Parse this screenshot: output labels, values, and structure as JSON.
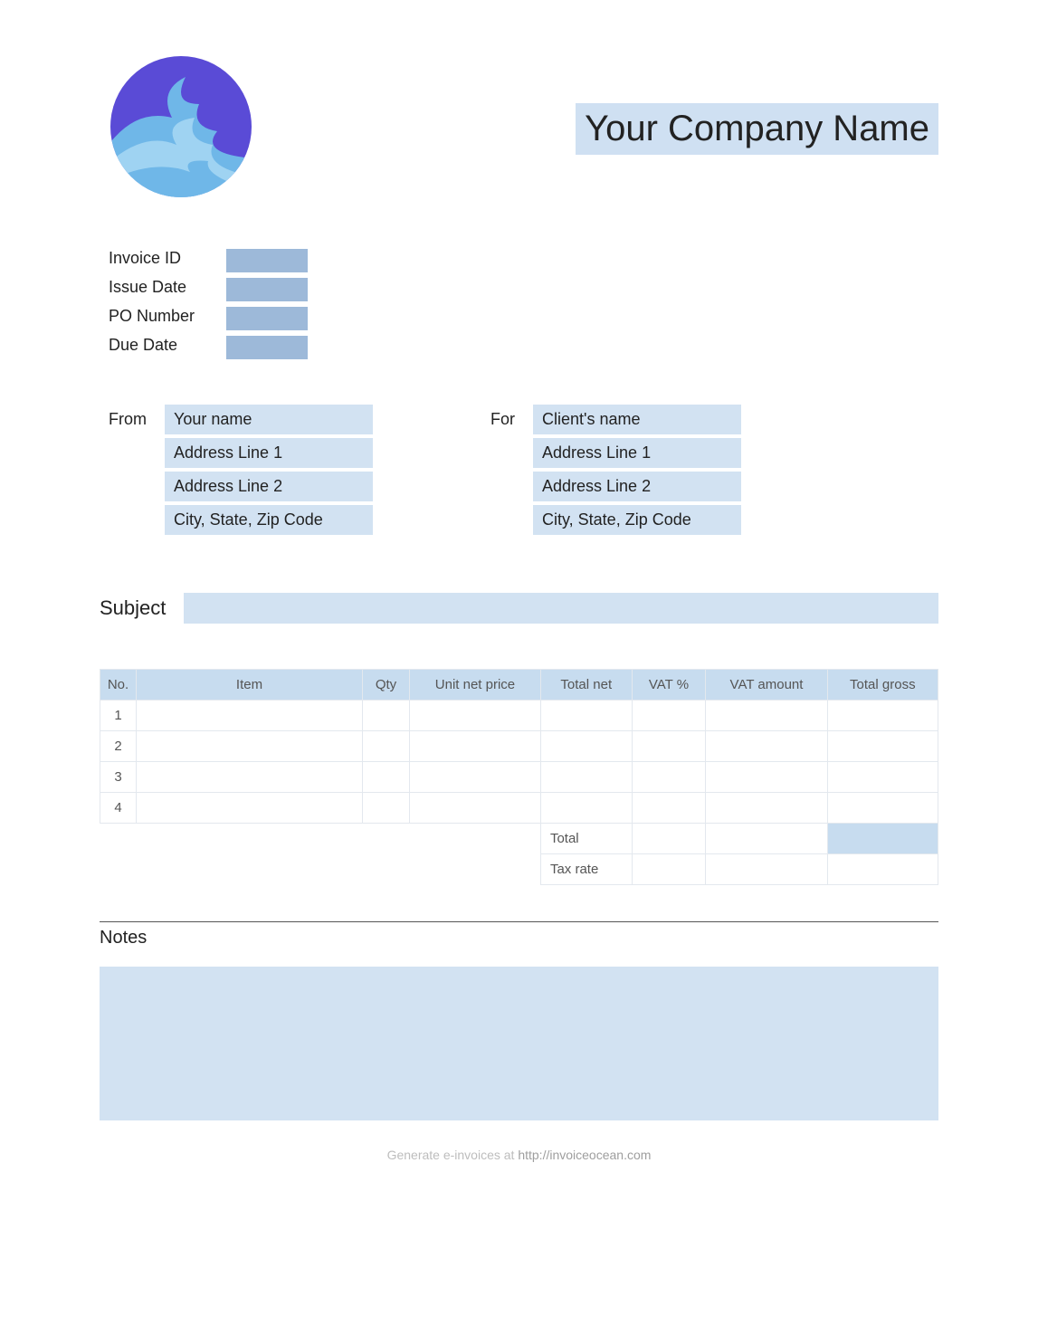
{
  "header": {
    "company_name": "Your Company Name"
  },
  "meta": {
    "invoice_id_label": "Invoice ID",
    "issue_date_label": "Issue Date",
    "po_number_label": "PO Number",
    "due_date_label": "Due Date",
    "invoice_id": "",
    "issue_date": "",
    "po_number": "",
    "due_date": ""
  },
  "from": {
    "label": "From",
    "lines": [
      "Your name",
      "Address Line 1",
      "Address Line 2",
      "City, State, Zip Code"
    ]
  },
  "for": {
    "label": "For",
    "lines": [
      "Client's name",
      "Address Line 1",
      "Address Line 2",
      "City, State, Zip Code"
    ]
  },
  "subject": {
    "label": "Subject",
    "value": ""
  },
  "table": {
    "headers": {
      "no": "No.",
      "item": "Item",
      "qty": "Qty",
      "unit_net_price": "Unit net price",
      "total_net": "Total net",
      "vat_pct": "VAT %",
      "vat_amount": "VAT amount",
      "total_gross": "Total gross"
    },
    "rows": [
      {
        "no": "1",
        "item": "",
        "qty": "",
        "unit_net_price": "",
        "total_net": "",
        "vat_pct": "",
        "vat_amount": "",
        "total_gross": ""
      },
      {
        "no": "2",
        "item": "",
        "qty": "",
        "unit_net_price": "",
        "total_net": "",
        "vat_pct": "",
        "vat_amount": "",
        "total_gross": ""
      },
      {
        "no": "3",
        "item": "",
        "qty": "",
        "unit_net_price": "",
        "total_net": "",
        "vat_pct": "",
        "vat_amount": "",
        "total_gross": ""
      },
      {
        "no": "4",
        "item": "",
        "qty": "",
        "unit_net_price": "",
        "total_net": "",
        "vat_pct": "",
        "vat_amount": "",
        "total_gross": ""
      }
    ],
    "totals": {
      "total_label": "Total",
      "tax_rate_label": "Tax rate",
      "total_vat_pct": "",
      "total_vat_amount": "",
      "total_gross": "",
      "tax_vat_pct": "",
      "tax_vat_amount": "",
      "tax_gross": ""
    }
  },
  "notes": {
    "label": "Notes",
    "value": ""
  },
  "footer": {
    "text": "Generate e-invoices at ",
    "link": "http://invoiceocean.com"
  }
}
